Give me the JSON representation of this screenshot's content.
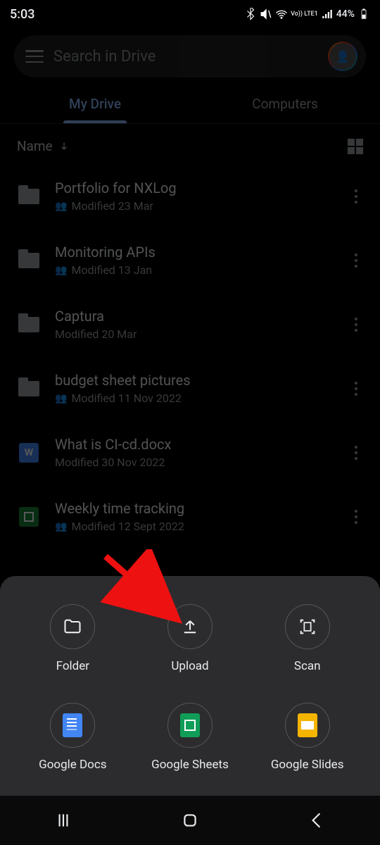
{
  "status": {
    "time": "5:03",
    "battery": "44%",
    "net_label": "Vo)) LTE1"
  },
  "search": {
    "placeholder": "Search in Drive"
  },
  "tabs": [
    {
      "label": "My Drive",
      "active": true
    },
    {
      "label": "Computers",
      "active": false
    }
  ],
  "sort": {
    "label": "Name"
  },
  "items": [
    {
      "name": "Portfolio for NXLog",
      "meta": "Modified 23 Mar",
      "shared": true,
      "kind": "folder"
    },
    {
      "name": "Monitoring APIs",
      "meta": "Modified 13 Jan",
      "shared": true,
      "kind": "folder"
    },
    {
      "name": "Captura",
      "meta": "Modified 20 Mar",
      "shared": false,
      "kind": "folder"
    },
    {
      "name": "budget sheet pictures",
      "meta": "Modified 11 Nov 2022",
      "shared": true,
      "kind": "folder"
    },
    {
      "name": "What is CI-cd.docx",
      "meta": "Modified 30 Nov 2022",
      "shared": false,
      "kind": "docx"
    },
    {
      "name": "Weekly time tracking",
      "meta": "Modified 12 Sept 2022",
      "shared": true,
      "kind": "sheet"
    }
  ],
  "sheet_actions": [
    {
      "label": "Folder",
      "icon": "folder"
    },
    {
      "label": "Upload",
      "icon": "upload"
    },
    {
      "label": "Scan",
      "icon": "scan"
    },
    {
      "label": "Google Docs",
      "icon": "docs"
    },
    {
      "label": "Google Sheets",
      "icon": "sheets"
    },
    {
      "label": "Google Slides",
      "icon": "slides"
    }
  ]
}
